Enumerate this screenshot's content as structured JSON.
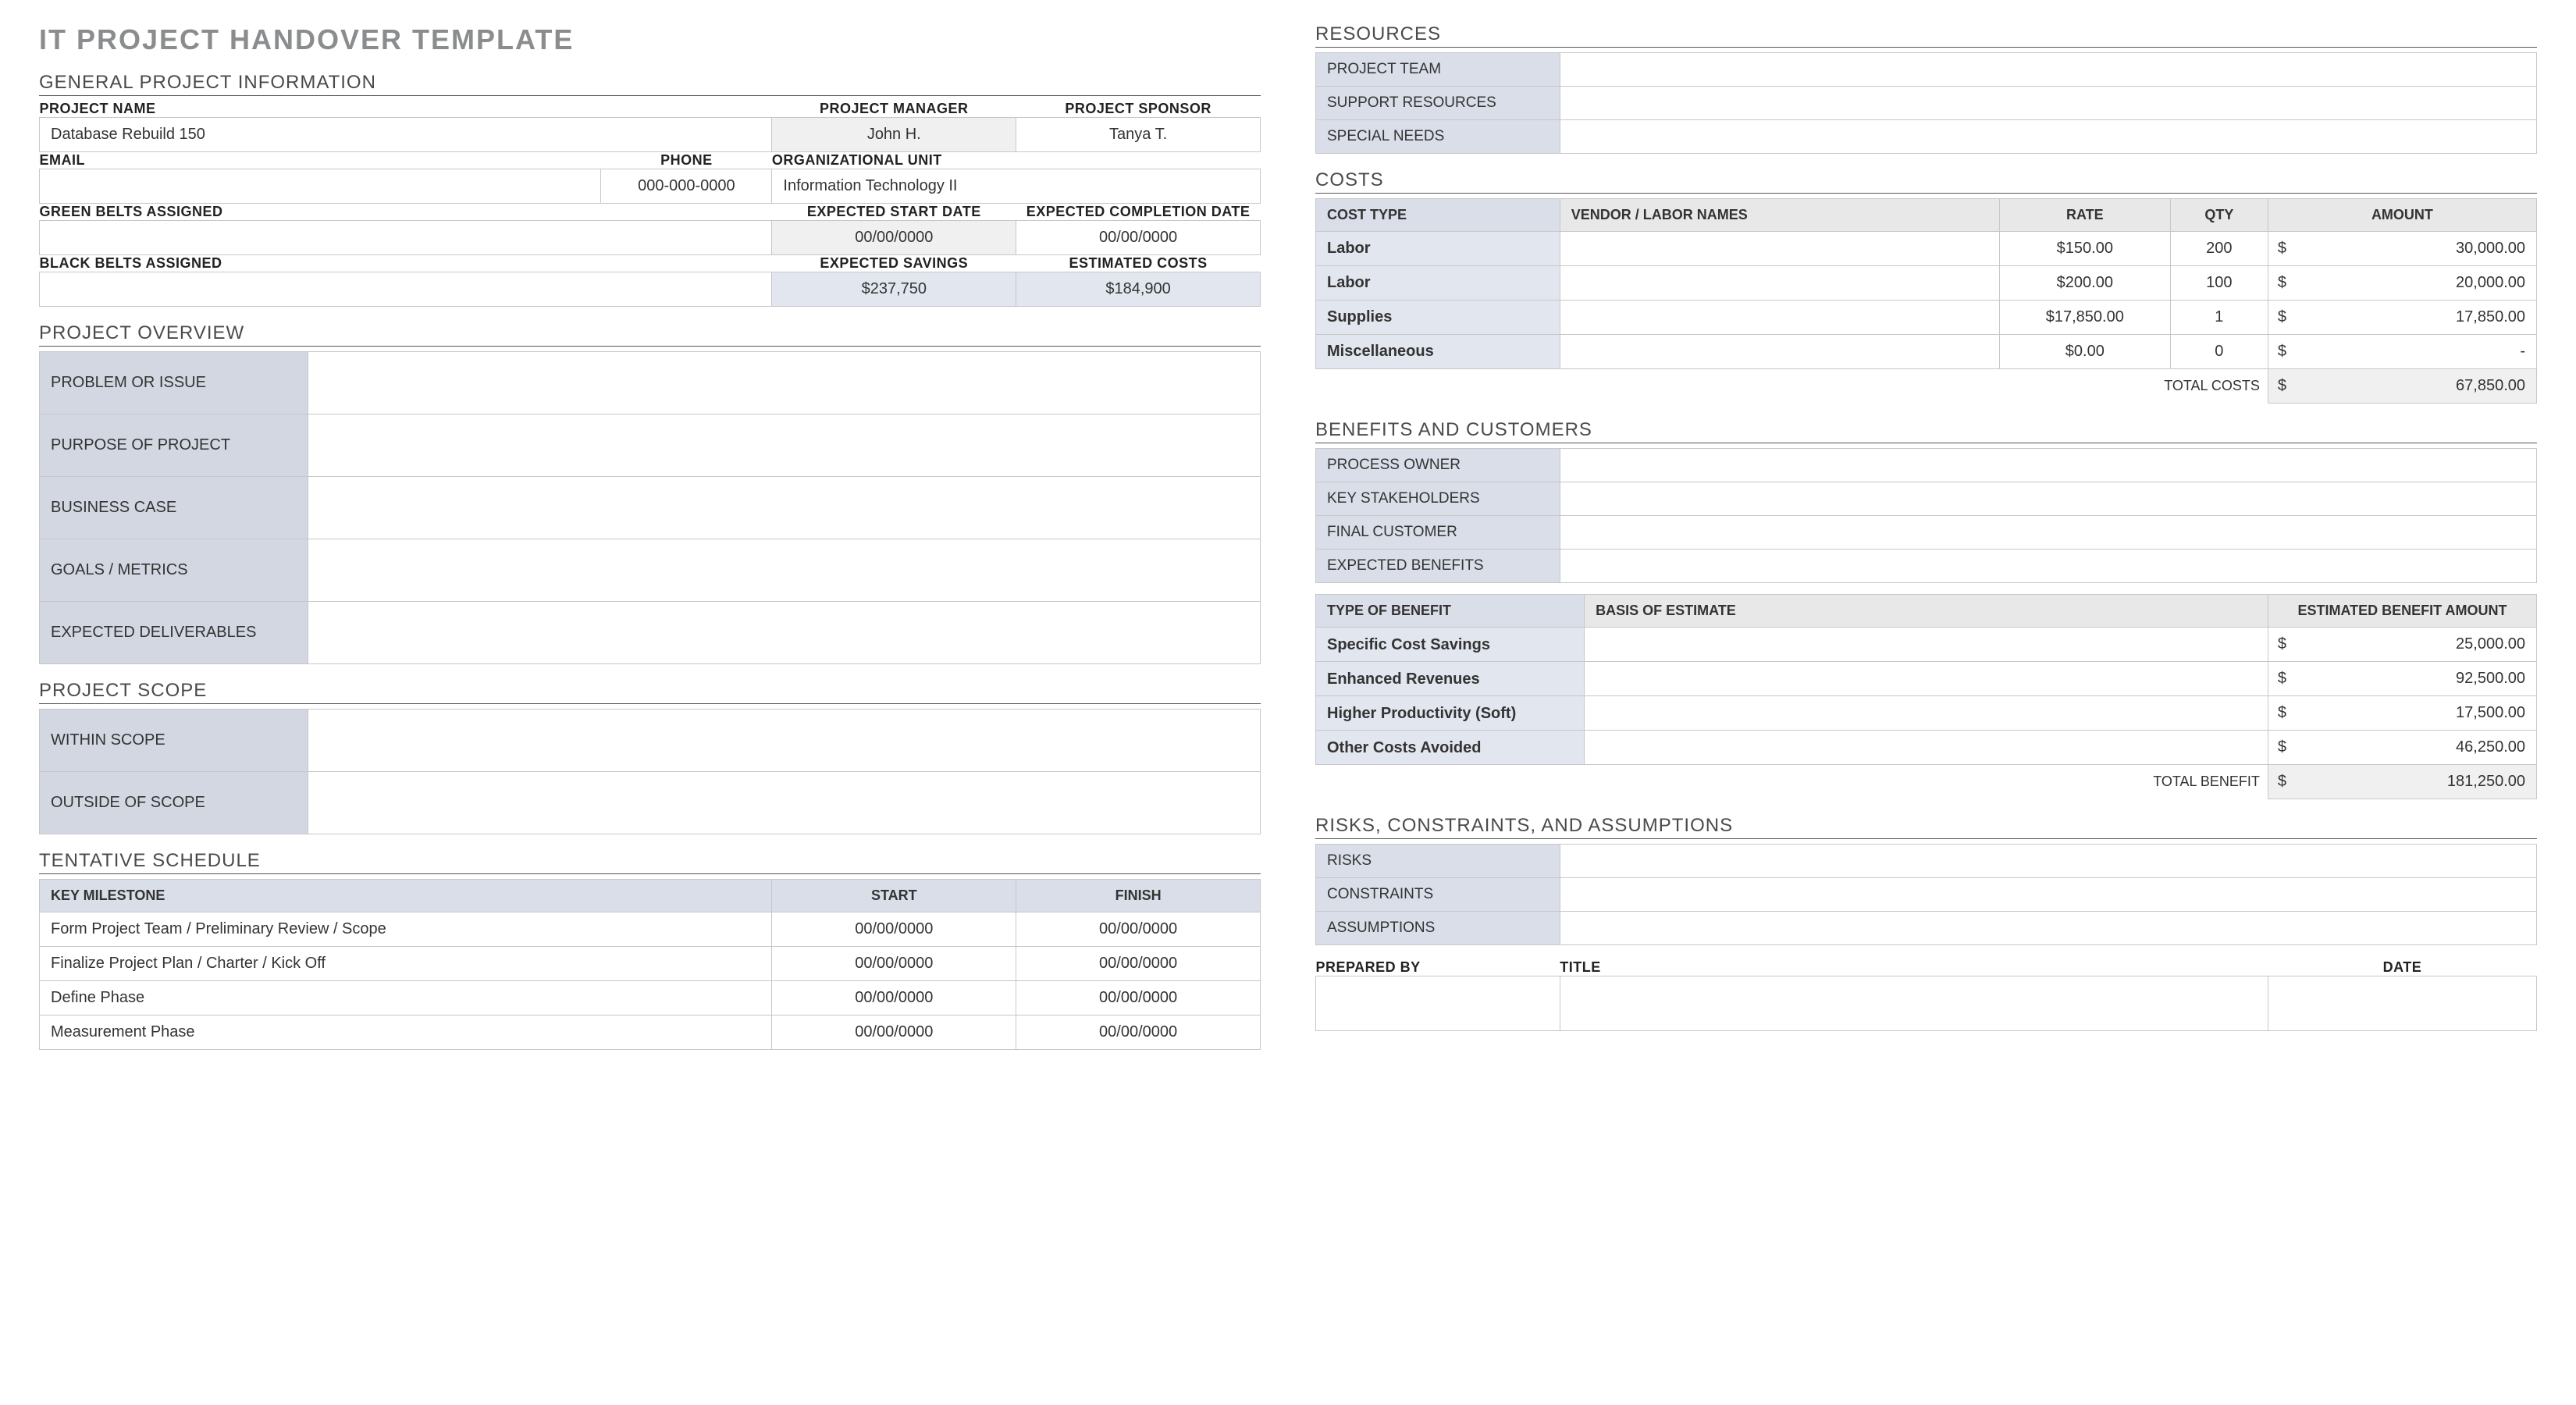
{
  "title": "IT PROJECT HANDOVER TEMPLATE",
  "sections": {
    "general": "GENERAL PROJECT INFORMATION",
    "overview": "PROJECT OVERVIEW",
    "scope": "PROJECT SCOPE",
    "schedule": "TENTATIVE SCHEDULE",
    "resources": "RESOURCES",
    "costs": "COSTS",
    "benefits": "BENEFITS AND CUSTOMERS",
    "risks": "RISKS, CONSTRAINTS, AND ASSUMPTIONS"
  },
  "general": {
    "labels": {
      "project_name": "PROJECT NAME",
      "project_manager": "PROJECT MANAGER",
      "project_sponsor": "PROJECT SPONSOR",
      "email": "EMAIL",
      "phone": "PHONE",
      "org_unit": "ORGANIZATIONAL UNIT",
      "green_belts": "GREEN BELTS ASSIGNED",
      "exp_start": "EXPECTED START DATE",
      "exp_complete": "EXPECTED COMPLETION DATE",
      "black_belts": "BLACK BELTS ASSIGNED",
      "exp_savings": "EXPECTED SAVINGS",
      "est_costs": "ESTIMATED COSTS"
    },
    "values": {
      "project_name": "Database Rebuild 150",
      "project_manager": "John H.",
      "project_sponsor": "Tanya T.",
      "email": "",
      "phone": "000-000-0000",
      "org_unit": "Information Technology II",
      "green_belts": "",
      "exp_start": "00/00/0000",
      "exp_complete": "00/00/0000",
      "black_belts": "",
      "exp_savings": "$237,750",
      "est_costs": "$184,900"
    }
  },
  "overview": {
    "rows": [
      {
        "label": "PROBLEM OR ISSUE",
        "value": ""
      },
      {
        "label": "PURPOSE OF PROJECT",
        "value": ""
      },
      {
        "label": "BUSINESS CASE",
        "value": ""
      },
      {
        "label": "GOALS / METRICS",
        "value": ""
      },
      {
        "label": "EXPECTED DELIVERABLES",
        "value": ""
      }
    ]
  },
  "scope": {
    "rows": [
      {
        "label": "WITHIN SCOPE",
        "value": ""
      },
      {
        "label": "OUTSIDE OF SCOPE",
        "value": ""
      }
    ]
  },
  "schedule": {
    "headers": {
      "milestone": "KEY MILESTONE",
      "start": "START",
      "finish": "FINISH"
    },
    "rows": [
      {
        "milestone": "Form Project Team / Preliminary Review / Scope",
        "start": "00/00/0000",
        "finish": "00/00/0000"
      },
      {
        "milestone": "Finalize Project Plan / Charter / Kick Off",
        "start": "00/00/0000",
        "finish": "00/00/0000"
      },
      {
        "milestone": "Define Phase",
        "start": "00/00/0000",
        "finish": "00/00/0000"
      },
      {
        "milestone": "Measurement Phase",
        "start": "00/00/0000",
        "finish": "00/00/0000"
      }
    ]
  },
  "resources": {
    "rows": [
      {
        "label": "PROJECT TEAM",
        "value": ""
      },
      {
        "label": "SUPPORT RESOURCES",
        "value": ""
      },
      {
        "label": "SPECIAL NEEDS",
        "value": ""
      }
    ]
  },
  "costs": {
    "headers": {
      "type": "COST TYPE",
      "vendor": "VENDOR / LABOR NAMES",
      "rate": "RATE",
      "qty": "QTY",
      "amount": "AMOUNT"
    },
    "rows": [
      {
        "type": "Labor",
        "vendor": "",
        "rate": "$150.00",
        "qty": "200",
        "amount": "30,000.00"
      },
      {
        "type": "Labor",
        "vendor": "",
        "rate": "$200.00",
        "qty": "100",
        "amount": "20,000.00"
      },
      {
        "type": "Supplies",
        "vendor": "",
        "rate": "$17,850.00",
        "qty": "1",
        "amount": "17,850.00"
      },
      {
        "type": "Miscellaneous",
        "vendor": "",
        "rate": "$0.00",
        "qty": "0",
        "amount": "-"
      }
    ],
    "total_label": "TOTAL COSTS",
    "total": "67,850.00"
  },
  "benefits_cust": {
    "rows": [
      {
        "label": "PROCESS OWNER",
        "value": ""
      },
      {
        "label": "KEY STAKEHOLDERS",
        "value": ""
      },
      {
        "label": "FINAL CUSTOMER",
        "value": ""
      },
      {
        "label": "EXPECTED BENEFITS",
        "value": ""
      }
    ]
  },
  "benefits_table": {
    "headers": {
      "type": "TYPE OF BENEFIT",
      "basis": "BASIS OF ESTIMATE",
      "amount": "ESTIMATED BENEFIT AMOUNT"
    },
    "rows": [
      {
        "type": "Specific Cost Savings",
        "basis": "",
        "amount": "25,000.00"
      },
      {
        "type": "Enhanced Revenues",
        "basis": "",
        "amount": "92,500.00"
      },
      {
        "type": "Higher Productivity (Soft)",
        "basis": "",
        "amount": "17,500.00"
      },
      {
        "type": "Other Costs Avoided",
        "basis": "",
        "amount": "46,250.00"
      }
    ],
    "total_label": "TOTAL BENEFIT",
    "total": "181,250.00"
  },
  "risks": {
    "rows": [
      {
        "label": "RISKS",
        "value": ""
      },
      {
        "label": "CONSTRAINTS",
        "value": ""
      },
      {
        "label": "ASSUMPTIONS",
        "value": ""
      }
    ]
  },
  "signoff": {
    "labels": {
      "prepared_by": "PREPARED BY",
      "title": "TITLE",
      "date": "DATE"
    },
    "values": {
      "prepared_by": "",
      "title": "",
      "date": ""
    }
  },
  "sym": {
    "dollar": "$"
  }
}
